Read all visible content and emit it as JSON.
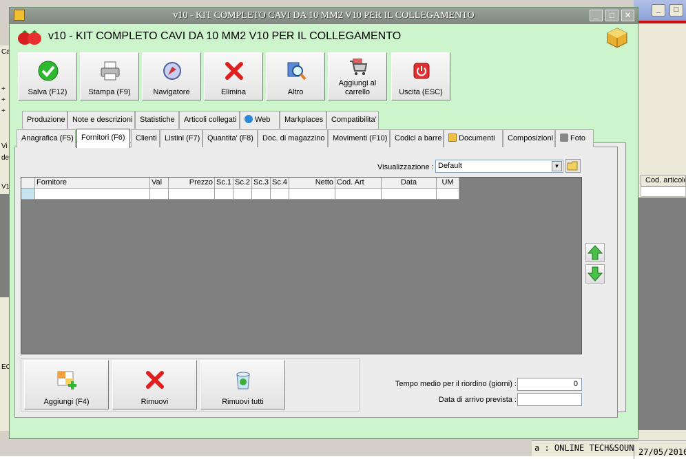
{
  "window": {
    "title": "v10 - KIT COMPLETO CAVI DA 10 MM2 V10 PER IL COLLEGAMENTO",
    "header_title": "v10 - KIT COMPLETO CAVI DA 10 MM2 V10 PER IL COLLEGAMENTO",
    "minimize": "_",
    "maximize": "□",
    "close": "✕"
  },
  "toolbar": {
    "save": "Salva (F12)",
    "print": "Stampa (F9)",
    "navigator": "Navigatore",
    "delete": "Elimina",
    "other": "Altro",
    "add_cart": "Aggiungi al carrello",
    "exit": "Uscita (ESC)"
  },
  "tabs_row1": [
    "Produzione",
    "Note e descrizioni",
    "Statistiche",
    "Articoli collegati",
    "Web",
    "Markplaces",
    "Compatibilita'"
  ],
  "tabs_row2": [
    "Anagrafica (F5)",
    "Fornitori (F6)",
    "Clienti",
    "Listini (F7)",
    "Quantita' (F8)",
    "Doc. di magazzino",
    "Movimenti (F10)",
    "Codici a barre",
    "Documenti",
    "Composizioni",
    "Foto"
  ],
  "view": {
    "label": "Visualizzazione :",
    "value": "Default"
  },
  "grid": {
    "columns": [
      "Fornitore",
      "Val",
      "Prezzo",
      "Sc.1",
      "Sc.2",
      "Sc.3",
      "Sc.4",
      "Netto",
      "Cod. Art",
      "Data",
      "UM"
    ],
    "rows": [
      [
        "",
        "",
        "",
        "",
        "",
        "",
        "",
        "",
        "",
        "",
        ""
      ]
    ]
  },
  "bottom_buttons": {
    "add": "Aggiungi (F4)",
    "remove": "Rimuovi",
    "remove_all": "Rimuovi tutti"
  },
  "fields": {
    "reorder_label": "Tempo medio per il riordino (giorni) :",
    "reorder_value": "0",
    "arrival_label": "Data di arrivo prevista :",
    "arrival_value": ""
  },
  "background": {
    "left_labels": [
      "Ca",
      "+",
      "+",
      "+",
      "Vi",
      "de",
      "V1",
      "EGA"
    ],
    "right_header": "Cod. articolo",
    "status_company": "a : ONLINE TECH&SOUND",
    "status_date": "27/05/2016"
  },
  "colors": {
    "window_bg": "#ccf5cc",
    "titlebar": "#8a938a",
    "grid_bg": "#808080",
    "selection": "#c6e4f0"
  }
}
